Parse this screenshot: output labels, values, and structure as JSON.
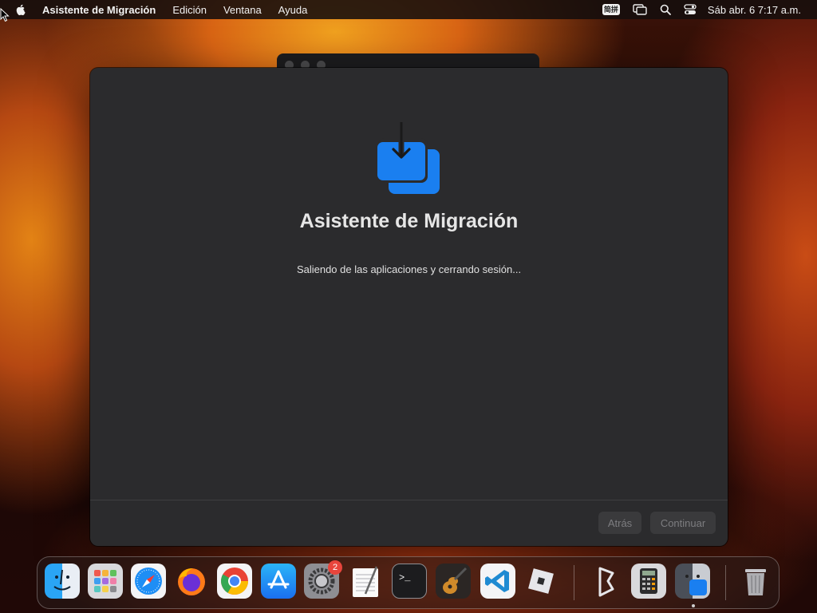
{
  "menubar": {
    "app_name": "Asistente de Migración",
    "items": [
      "Edición",
      "Ventana",
      "Ayuda"
    ],
    "ime_label": "简拼",
    "clock": "Sáb abr. 6  7:17 a.m."
  },
  "window": {
    "title": "Asistente de Migración",
    "status_text": "Saliendo de las aplicaciones y cerrando sesión...",
    "back_label": "Atrás",
    "continue_label": "Continuar"
  },
  "dock": {
    "apps": [
      "Finder",
      "Launchpad",
      "Safari",
      "Firefox",
      "Google Chrome",
      "App Store",
      "System Settings",
      "TextEdit",
      "Terminal",
      "GarageBand",
      "Visual Studio Code",
      "Roblox",
      "Bitwarden",
      "Calculator",
      "Migration Assistant",
      "Trash"
    ],
    "settings_badge": "2"
  },
  "colors": {
    "accent": "#1a7ff0",
    "window_bg": "#2b2b2d"
  }
}
